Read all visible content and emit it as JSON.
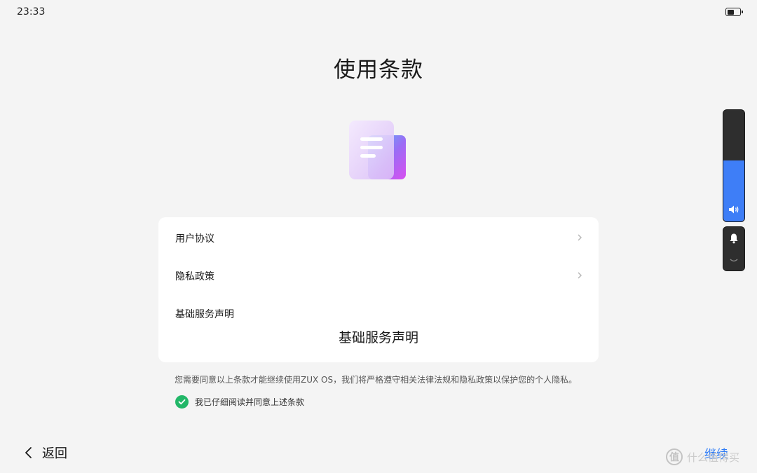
{
  "status_bar": {
    "time": "23:33",
    "battery_level": 0.6
  },
  "title": "使用条款",
  "card": {
    "rows": [
      {
        "label": "用户协议",
        "chevron": true
      },
      {
        "label": "隐私政策",
        "chevron": true
      },
      {
        "label": "基础服务声明",
        "chevron": false
      }
    ],
    "tooltip": "基础服务声明"
  },
  "notice": "您需要同意以上条款才能继续使用ZUX OS，我们将严格遵守相关法律法规和隐私政策以保护您的个人隐私。",
  "agree": {
    "label": "我已仔细阅读并同意上述条款",
    "checked": true
  },
  "footer": {
    "back_label": "返回",
    "continue_label": "继续"
  },
  "watermark": {
    "logo": "值",
    "text": "什么值得买"
  },
  "volume": {
    "level": 0.55
  },
  "colors": {
    "accent": "#2f7cf6",
    "check": "#22b768",
    "volume": "#3e7ef7"
  }
}
